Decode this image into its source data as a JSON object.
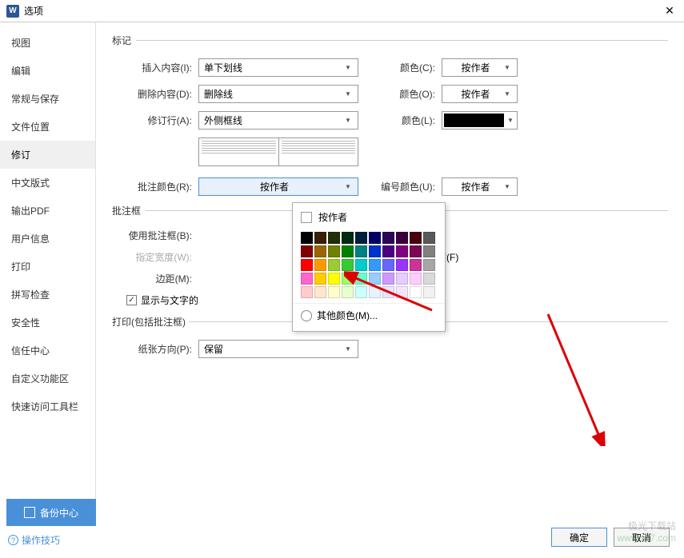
{
  "titlebar": {
    "icon": "W",
    "title": "选项"
  },
  "sidebar": {
    "items": [
      {
        "label": "视图"
      },
      {
        "label": "编辑"
      },
      {
        "label": "常规与保存"
      },
      {
        "label": "文件位置"
      },
      {
        "label": "修订",
        "active": true
      },
      {
        "label": "中文版式"
      },
      {
        "label": "输出PDF"
      },
      {
        "label": "用户信息"
      },
      {
        "label": "打印"
      },
      {
        "label": "拼写检查"
      },
      {
        "label": "安全性"
      },
      {
        "label": "信任中心"
      },
      {
        "label": "自定义功能区"
      },
      {
        "label": "快速访问工具栏"
      }
    ]
  },
  "sections": {
    "marks": {
      "title": "标记",
      "insert": {
        "label": "插入内容(I):",
        "value": "单下划线",
        "colorLabel": "颜色(C):",
        "colorValue": "按作者"
      },
      "delete": {
        "label": "删除内容(D):",
        "value": "删除线",
        "colorLabel": "颜色(O):",
        "colorValue": "按作者"
      },
      "changed": {
        "label": "修订行(A):",
        "value": "外侧框线",
        "colorLabel": "颜色(L):"
      },
      "comment": {
        "label": "批注颜色(R):",
        "value": "按作者",
        "numColorLabel": "编号颜色(U):",
        "numColorValue": "按作者"
      }
    },
    "balloon": {
      "title": "批注框",
      "use": {
        "label": "使用批注框(B):"
      },
      "width": {
        "label": "指定宽度(W):"
      },
      "recWidth": {
        "label": "使用推荐宽度(F)"
      },
      "margin": {
        "label": "边距(M):"
      },
      "showLines": {
        "label": "显示与文字的"
      }
    },
    "print": {
      "title": "打印(包括批注框)",
      "orient": {
        "label": "纸张方向(P):",
        "value": "保留"
      }
    }
  },
  "colorPicker": {
    "byAuthor": "按作者",
    "moreColors": "其他颜色(M)...",
    "colors": [
      [
        "#000000",
        "#3b1f04",
        "#1f3004",
        "#002a11",
        "#001e3d",
        "#000066",
        "#2b0857",
        "#3b003b",
        "#4b000f",
        "#595959"
      ],
      [
        "#800000",
        "#9c6500",
        "#728000",
        "#008000",
        "#008080",
        "#0033cc",
        "#4b0082",
        "#800080",
        "#7d0552",
        "#808080"
      ],
      [
        "#ff0000",
        "#ff9900",
        "#9acd32",
        "#33cc33",
        "#00cccc",
        "#3399ff",
        "#6666ff",
        "#9933ff",
        "#cc3399",
        "#a6a6a6"
      ],
      [
        "#ff66cc",
        "#ffcc00",
        "#ffff00",
        "#99ff66",
        "#66ffcc",
        "#99ccff",
        "#cc99ff",
        "#e6ccff",
        "#ffccff",
        "#d9d9d9"
      ],
      [
        "#ffcccc",
        "#ffe6cc",
        "#ffffcc",
        "#e6ffcc",
        "#ccffff",
        "#e6f2ff",
        "#e6e6ff",
        "#f2e6ff",
        "#ffffff",
        "#f2f2f2"
      ]
    ]
  },
  "footer": {
    "backup": "备份中心",
    "tips": "操作技巧",
    "ok": "确定",
    "cancel": "取消"
  },
  "watermark": {
    "line1": "极光下载站",
    "line2": "www.xz7.com"
  }
}
